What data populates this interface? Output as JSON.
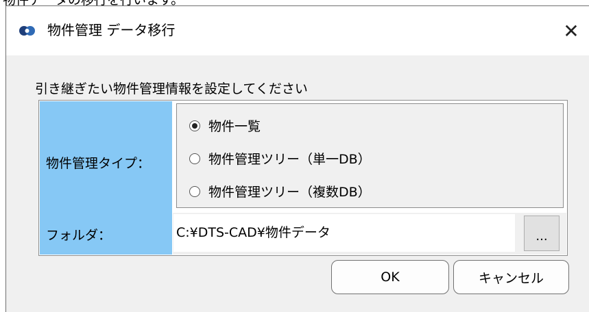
{
  "above_text": "物件データの移行を行います。",
  "window": {
    "title": "物件管理 データ移行",
    "close_glyph": "✕"
  },
  "instruction": "引き継ぎたい物件管理情報を設定してください",
  "form": {
    "type_label": "物件管理タイプ：",
    "options": [
      {
        "label": "物件一覧",
        "selected": true
      },
      {
        "label": "物件管理ツリー（単一DB）",
        "selected": false
      },
      {
        "label": "物件管理ツリー（複数DB）",
        "selected": false
      }
    ],
    "folder_label": "フォルダ：",
    "folder_value": "C:¥DTS-CAD¥物件データ",
    "browse_label": "..."
  },
  "buttons": {
    "ok": "OK",
    "cancel": "キャンセル"
  },
  "colors": {
    "label_bg": "#86c8f5",
    "dialog_bg": "#f0f0f0"
  },
  "icons": {
    "app": "app-logo-icon",
    "close": "close-icon"
  }
}
